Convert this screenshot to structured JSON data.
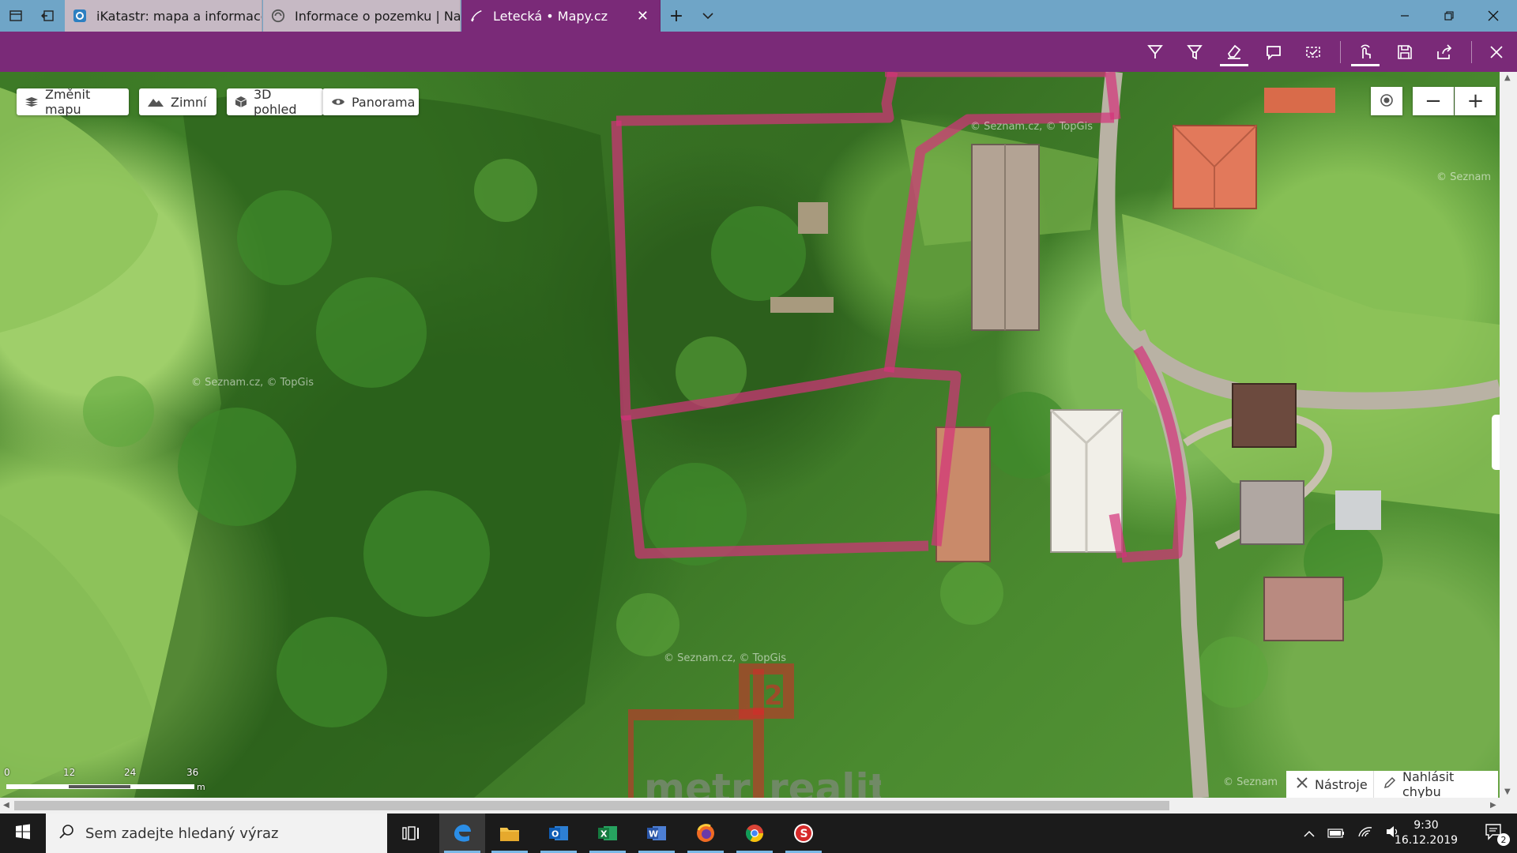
{
  "browser": {
    "tabs": [
      {
        "title": "iKatastr: mapa a informace z",
        "icon": "ikatastr-icon",
        "active": false
      },
      {
        "title": "Informace o pozemku | Nah",
        "icon": "cuzk-icon",
        "active": false
      },
      {
        "title": "Letecká • Mapy.cz",
        "icon": "mapy-cz-icon",
        "active": true
      }
    ],
    "new_tab_label": "+",
    "tab_list_label": "⌄"
  },
  "map": {
    "controls": {
      "change_map": "Změnit mapu",
      "winter": "Zimní",
      "view_3d": "3D pohled",
      "panorama": "Panorama"
    },
    "zoom_out": "−",
    "zoom_in": "+",
    "watermarks": [
      "© Seznam.cz, © TopGis",
      "© Seznam.cz, © TopGis",
      "© Seznam.cz, © TopGis",
      "© Seznam",
      "© Seznam"
    ],
    "scale": {
      "ticks": [
        "0",
        "12",
        "24",
        "36"
      ],
      "unit": "m"
    },
    "bottom_tools": {
      "tools": "Nástroje",
      "report_error": "Nahlásit chybu"
    },
    "parcel_label": "2",
    "overlay_text": {
      "left": "metr",
      "right": "reality",
      "mark": "®"
    }
  },
  "taskbar": {
    "search_placeholder": "Sem zadejte hledaný výraz",
    "apps": [
      "task-view-icon",
      "edge-icon",
      "file-explorer-icon",
      "outlook-icon",
      "excel-icon",
      "word-icon",
      "firefox-icon",
      "chrome-icon",
      "app-s-icon"
    ],
    "time": "9:30",
    "date": "16.12.2019",
    "notifications_count": "2"
  },
  "colors": {
    "tab_bar": "#6fa5c7",
    "inactive_tab": "#c6b9c4",
    "active_tab": "#7a2a78",
    "ink_toolbar": "#7a2a78",
    "parcel_outline": "#d4327a",
    "overlay_red": "#d62a2a",
    "taskbar": "#1b1b1b"
  }
}
